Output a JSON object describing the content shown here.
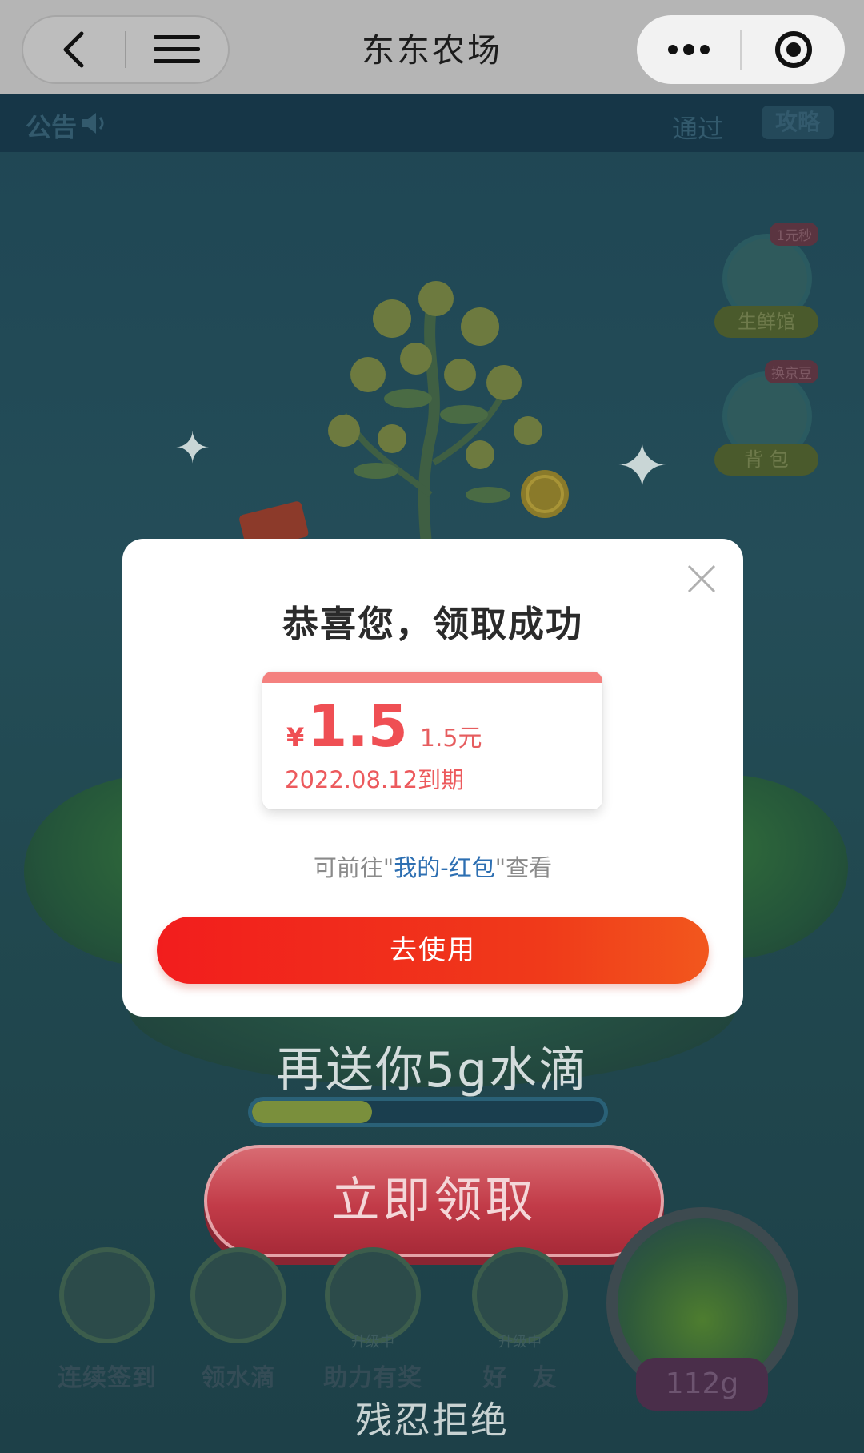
{
  "navbar": {
    "title": "东东农场",
    "back_icon": "chevron-left-icon",
    "menu_icon": "hamburger-menu-icon",
    "more_icon": "more-dots-icon",
    "close_icon": "target-circle-icon"
  },
  "notice_bar": {
    "label": "公告",
    "speaker_icon": "speaker-icon",
    "pass_text": "通过",
    "guide_label": "攻略"
  },
  "side_buttons": [
    {
      "label": "生鲜馆",
      "tag": "1元秒"
    },
    {
      "label": "背 包",
      "tag": "换京豆"
    }
  ],
  "background": {
    "again_text": "再送你5g水滴",
    "progress_fraction": 0.34,
    "claim_button": "立即领取",
    "refuse_link": "残忍拒绝"
  },
  "toolbar": {
    "items": [
      {
        "label": "连续签到",
        "sub": ""
      },
      {
        "label": "领水滴",
        "sub": ""
      },
      {
        "label": "助力有奖",
        "sub": "升级中"
      },
      {
        "label": "好　友",
        "sub": "升级中"
      }
    ],
    "bottle_weight": "112g"
  },
  "modal": {
    "title": "恭喜您，领取成功",
    "coupon": {
      "currency": "¥",
      "value": "1.5",
      "unit_text": "1.5元",
      "expiry": "2022.08.12到期"
    },
    "hint_prefix": "可前往\"",
    "hint_link": "我的-红包",
    "hint_suffix": "\"查看",
    "use_button": "去使用"
  },
  "colors": {
    "accent_red": "#f21d1d",
    "coupon_red": "#ef4f54",
    "link_blue": "#2d6fb2"
  }
}
